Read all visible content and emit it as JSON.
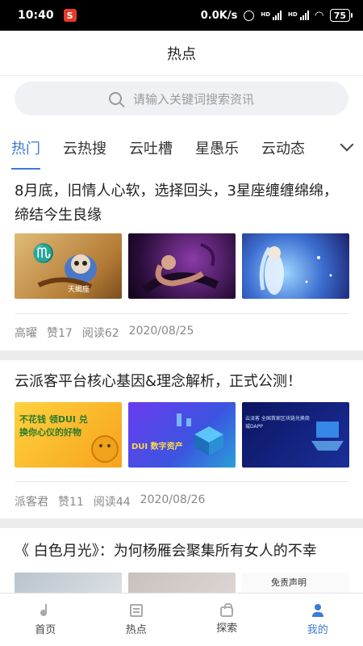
{
  "status_bar": {
    "time": "10:40",
    "app_badge": "S",
    "net_speed": "0.0K/s",
    "battery": "75"
  },
  "header": {
    "title": "热点"
  },
  "search": {
    "placeholder": "请输入关键词搜索资讯"
  },
  "tabs": [
    "热门",
    "云热搜",
    "云吐槽",
    "星愚乐",
    "云动态"
  ],
  "articles": [
    {
      "title": "8月底，旧情人心软，选择回头，3星座缠缠绵绵，缔结今生良缘",
      "thumb_text": [
        "天蝎座",
        "",
        ""
      ],
      "author": "高曜",
      "likes": "赞17",
      "reads": "阅读62",
      "date": "2020/08/25"
    },
    {
      "title": "云派客平台核心基因&理念解析，正式公测！",
      "thumb_text": [
        "不花钱 领DUI 兑换你心仪的好物",
        "DUI 数字资产",
        "云派客 全国首家区块链兑换商城DAPP"
      ],
      "author": "派客君",
      "likes": "赞11",
      "reads": "阅读44",
      "date": "2020/08/26"
    },
    {
      "title": "《 白色月光》：为何杨雁会聚集所有女人的不幸",
      "thumb_text": [
        "",
        "",
        "免责声明"
      ]
    }
  ],
  "tabbar": [
    "首页",
    "热点",
    "探索",
    "我的"
  ],
  "colors": {
    "accent": "#3a7bd5"
  }
}
